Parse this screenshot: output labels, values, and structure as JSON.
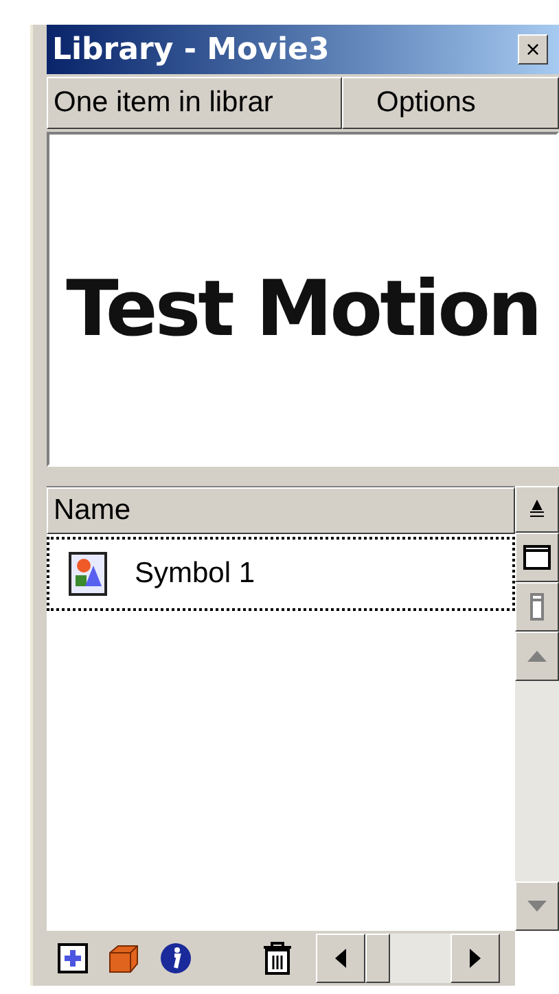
{
  "window": {
    "title": "Library - Movie3",
    "close": "×"
  },
  "tabs": [
    {
      "label": "One item in librar"
    },
    {
      "label": "Options"
    }
  ],
  "preview": {
    "text": "Test Motion"
  },
  "list": {
    "columns": [
      "Name"
    ],
    "rows": [
      {
        "name": "Symbol 1",
        "selected": true
      }
    ]
  }
}
